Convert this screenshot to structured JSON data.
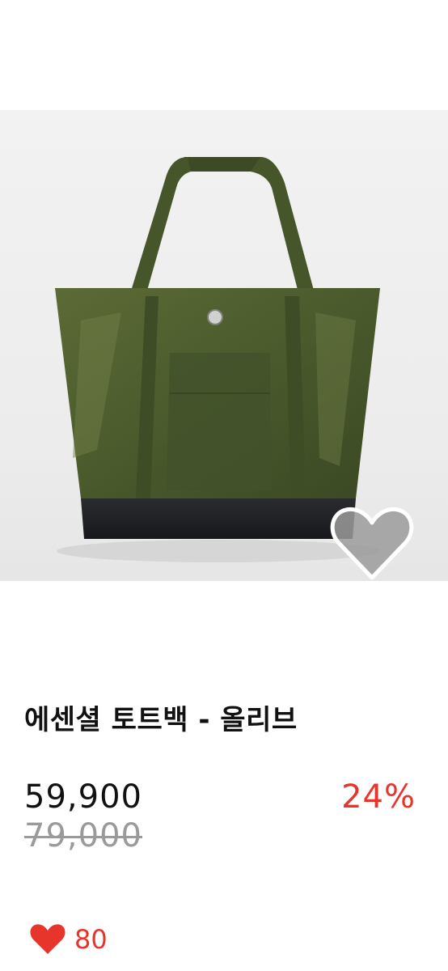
{
  "product": {
    "image_alt": "에센셜 토트백 - 올리브",
    "title": "에센셜 토트백 - 올리브",
    "price": "59,900",
    "discount": "24%",
    "original_price": "79,000",
    "likes": "80"
  },
  "icons": {
    "favorite": "heart-outline-icon",
    "likes": "heart-filled-icon"
  },
  "colors": {
    "accent": "#e8352b",
    "bag_olive": "#4a5a2c",
    "bag_base": "#1e2024"
  }
}
